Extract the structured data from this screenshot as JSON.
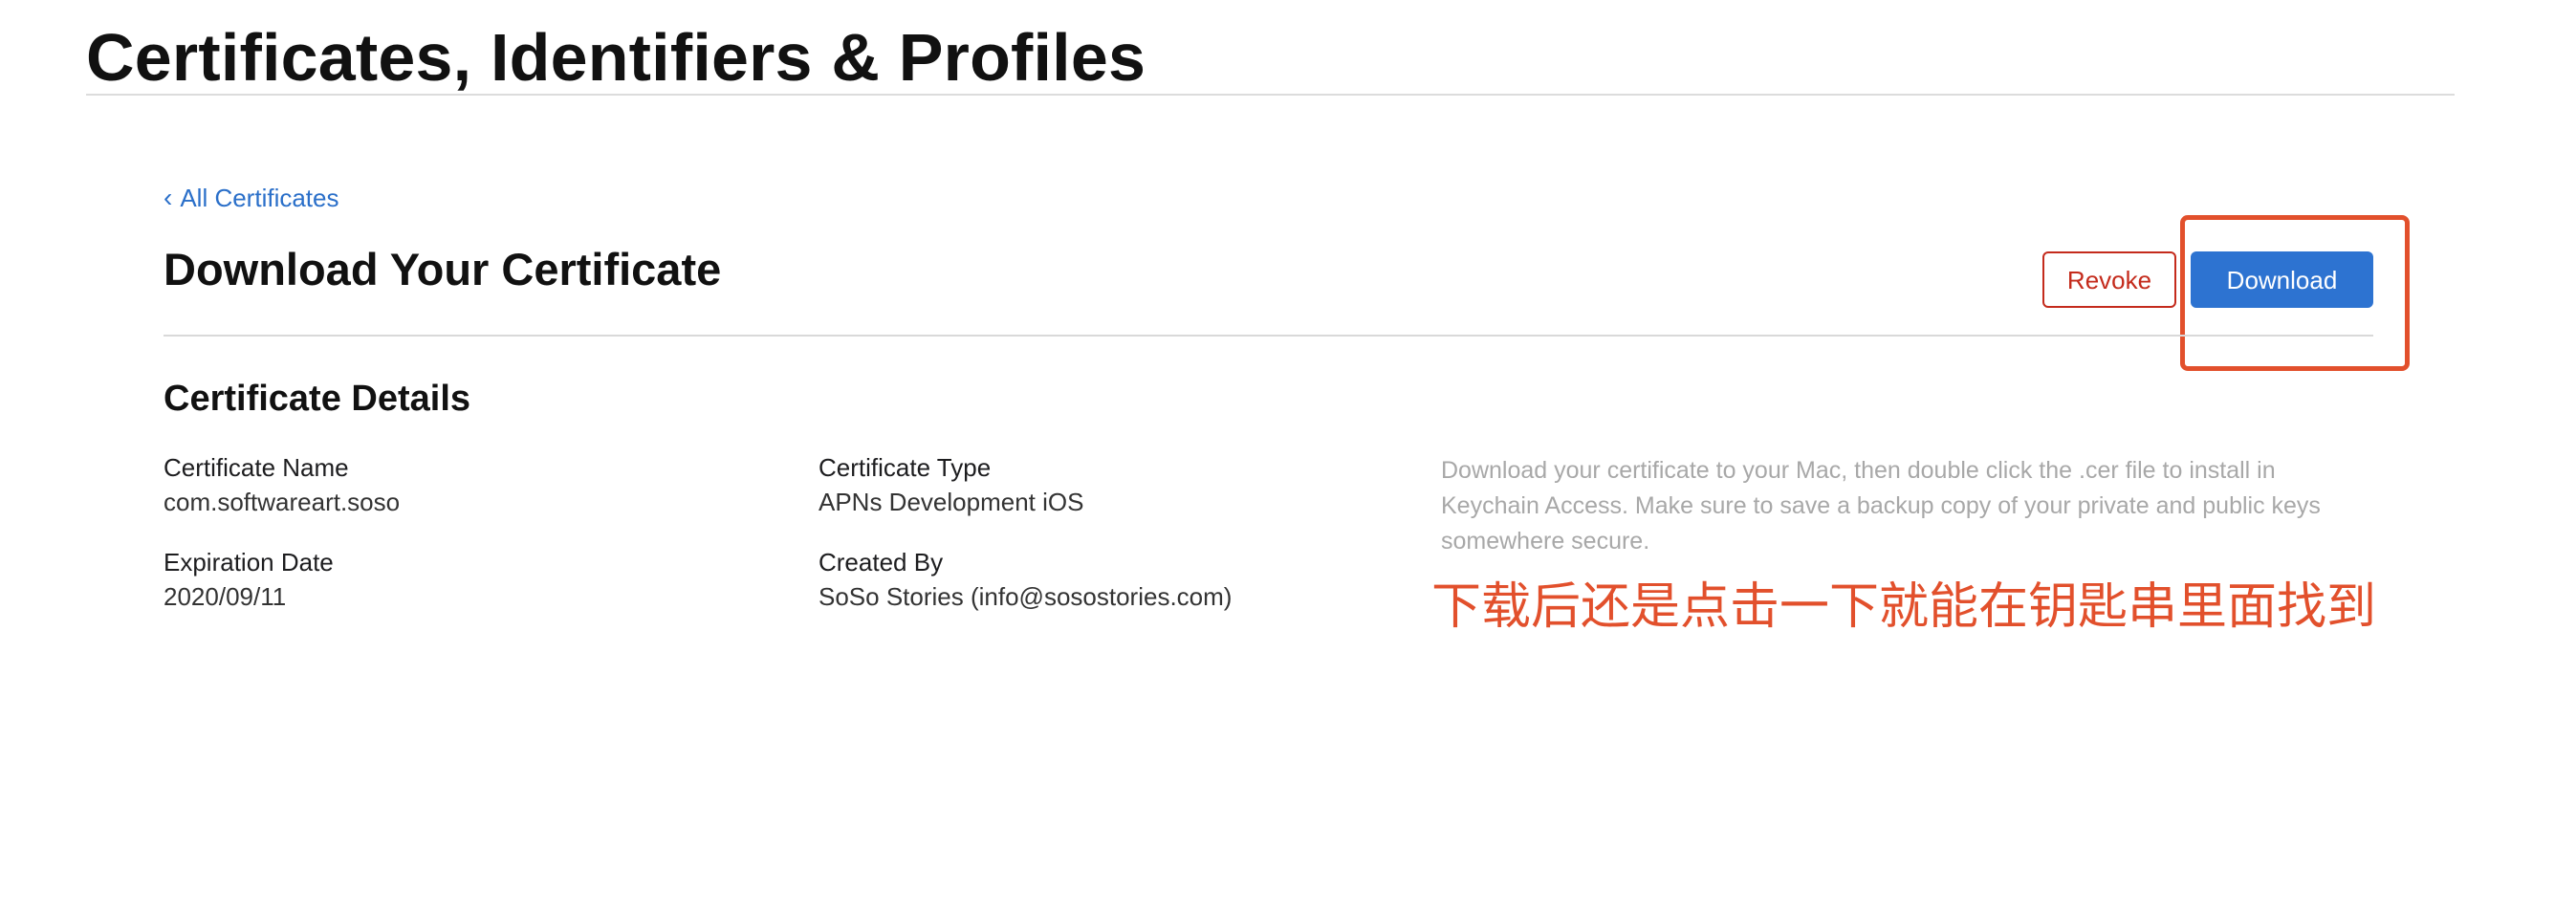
{
  "header": {
    "title": "Certificates, Identifiers & Profiles"
  },
  "nav": {
    "back_chevron": "‹",
    "back_label": "All Certificates"
  },
  "certificate_page": {
    "title": "Download Your Certificate",
    "revoke_label": "Revoke",
    "download_label": "Download"
  },
  "details": {
    "title": "Certificate Details",
    "certificate_name": {
      "label": "Certificate Name",
      "value": "com.softwareart.soso"
    },
    "expiration_date": {
      "label": "Expiration Date",
      "value": "2020/09/11"
    },
    "certificate_type": {
      "label": "Certificate Type",
      "value": "APNs Development iOS"
    },
    "created_by": {
      "label": "Created By",
      "value": "SoSo Stories (info@sosostories.com)"
    },
    "help_text": "Download your certificate to your Mac, then double click the .cer file to install in Keychain Access. Make sure to save a backup copy of your private and public keys somewhere secure."
  },
  "annotation": {
    "note": "下载后还是点击一下就能在钥匙串里面找到"
  },
  "colors": {
    "link": "#2a6fc9",
    "primary_button": "#2d73d1",
    "destructive": "#c42b1c",
    "annotation": "#e2502c",
    "muted_text": "#a8a8a8"
  }
}
